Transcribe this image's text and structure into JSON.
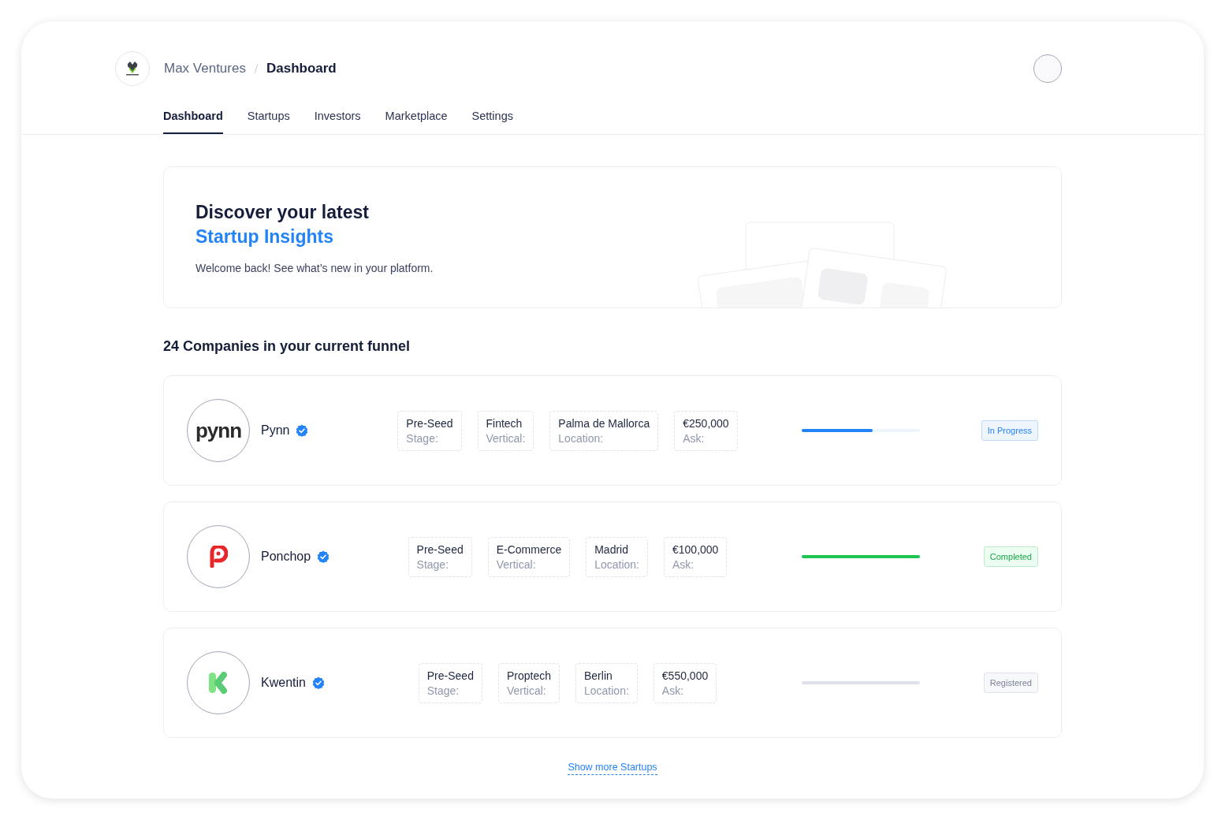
{
  "header": {
    "breadcrumb": [
      {
        "label": "Max Ventures",
        "selected": false
      },
      {
        "label": "Dashboard",
        "selected": true
      }
    ]
  },
  "tabs": [
    {
      "label": "Dashboard",
      "selected": true
    },
    {
      "label": "Startups",
      "selected": false
    },
    {
      "label": "Investors",
      "selected": false
    },
    {
      "label": "Marketplace",
      "selected": false
    },
    {
      "label": "Settings",
      "selected": false
    }
  ],
  "hero": {
    "title": "Discover your latest",
    "highlight": "Startup Insights",
    "subtitle": "Welcome back! See what’s new in your platform."
  },
  "funnel": {
    "heading": "24 Companies in your current funnel",
    "companies": [
      {
        "name": "Pynn",
        "kind": "wordmark",
        "logo_text": "pynn",
        "verified": true,
        "fields": [
          {
            "value": "Pre-Seed",
            "label": "Stage:"
          },
          {
            "value": "Fintech",
            "label": "Vertical:"
          },
          {
            "value": "Palma de Mallorca",
            "label": "Location:"
          },
          {
            "value": "€250,000",
            "label": "Ask:"
          }
        ],
        "level": 0.6,
        "status": {
          "kind": "progress",
          "label": "In Progress"
        }
      },
      {
        "name": "Ponchop",
        "kind": "p-mark",
        "verified": true,
        "fields": [
          {
            "value": "Pre-Seed",
            "label": "Stage:"
          },
          {
            "value": "E-Commerce",
            "label": "Vertical:"
          },
          {
            "value": "Madrid",
            "label": "Location:"
          },
          {
            "value": "€100,000",
            "label": "Ask:"
          }
        ],
        "level": 1,
        "status": {
          "kind": "completed",
          "label": "Completed"
        }
      },
      {
        "name": "Kwentin",
        "kind": "k-mark",
        "verified": true,
        "fields": [
          {
            "value": "Pre-Seed",
            "label": "Stage:"
          },
          {
            "value": "Proptech",
            "label": "Vertical:"
          },
          {
            "value": "Berlin",
            "label": "Location:"
          },
          {
            "value": "€550,000",
            "label": "Ask:"
          }
        ],
        "level": 0,
        "status": {
          "kind": "registered",
          "label": "Registered"
        }
      }
    ],
    "more_link": "Show more Startups"
  }
}
